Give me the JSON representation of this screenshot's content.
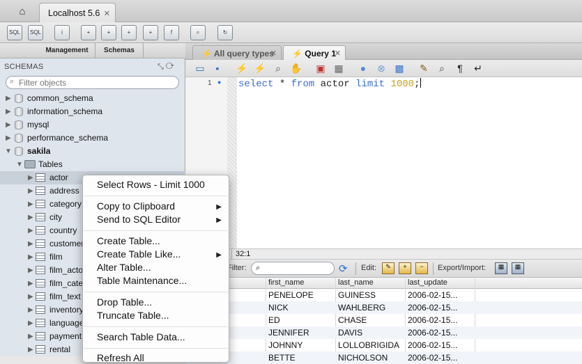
{
  "window": {
    "connection_tab": "Localhost 5.6"
  },
  "sidebar": {
    "tabs": [
      "Management",
      "Schemas"
    ],
    "header": "SCHEMAS",
    "filter_placeholder": "Filter objects",
    "schemas": [
      "common_schema",
      "information_schema",
      "mysql",
      "performance_schema",
      "sakila"
    ],
    "tables_label": "Tables",
    "tables": [
      "actor",
      "address",
      "category",
      "city",
      "country",
      "customer",
      "film",
      "film_actor",
      "film_category",
      "film_text",
      "inventory",
      "language",
      "payment",
      "rental"
    ]
  },
  "editor": {
    "tabs": [
      {
        "label": "All query types"
      },
      {
        "label": "Query 1"
      }
    ],
    "line_number": "1",
    "code": {
      "kw1": "select",
      "star": " * ",
      "kw2": "from",
      "ident": " actor ",
      "kw3": "limit",
      "num": " 1000",
      "semi": ";"
    },
    "cursor_position": "32:1"
  },
  "results": {
    "filter_label": "Filter:",
    "edit_label": "Edit:",
    "export_label": "Export/Import:",
    "columns": [
      "first_name",
      "last_name",
      "last_update"
    ],
    "rows": [
      [
        "PENELOPE",
        "GUINESS",
        "2006-02-15..."
      ],
      [
        "NICK",
        "WAHLBERG",
        "2006-02-15..."
      ],
      [
        "ED",
        "CHASE",
        "2006-02-15..."
      ],
      [
        "JENNIFER",
        "DAVIS",
        "2006-02-15..."
      ],
      [
        "JOHNNY",
        "LOLLOBRIGIDA",
        "2006-02-15..."
      ],
      [
        "BETTE",
        "NICHOLSON",
        "2006-02-15..."
      ]
    ]
  },
  "context_menu": {
    "items": [
      "Select Rows - Limit 1000",
      "Copy to Clipboard",
      "Send to SQL Editor",
      "Create Table...",
      "Create Table Like...",
      "Alter Table...",
      "Table Maintenance...",
      "Drop Table...",
      "Truncate Table...",
      "Search Table Data...",
      "Refresh All"
    ]
  },
  "colors": {
    "keyword": "#3a6fd0",
    "number": "#c8a020",
    "sidebar_bg": "#dfe5ed"
  }
}
